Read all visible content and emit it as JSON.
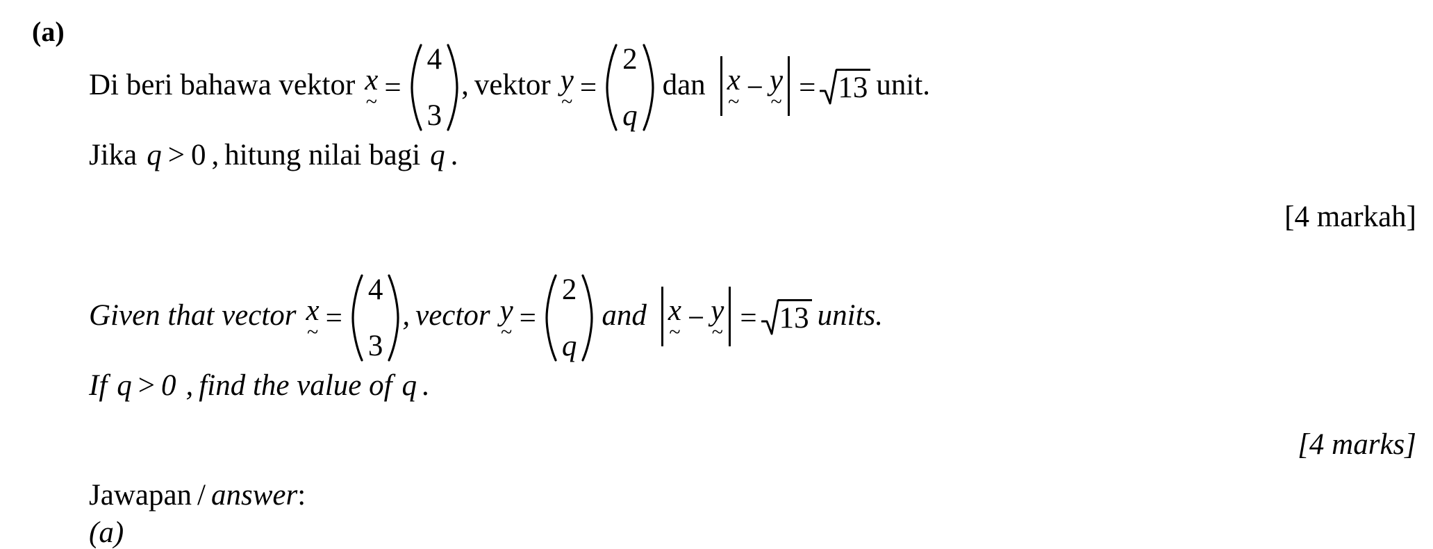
{
  "question": {
    "part_label": "(a)",
    "malay": {
      "line1": {
        "prefix": "Di beri bahawa vektor",
        "var1": "x",
        "equals": "=",
        "vector1": {
          "top": "4",
          "bottom": "3"
        },
        "comma": ",",
        "mid": "vektor",
        "var2": "y",
        "vector2": {
          "top": "2",
          "bottom": "q"
        },
        "conj": "dan",
        "abs_left_var": "x",
        "minus": "−",
        "abs_right_var": "y",
        "equals2": "=",
        "radicand": "13",
        "unit": "unit."
      },
      "line2": {
        "prefix": "Jika",
        "cond_var": "q",
        "cond_op": ">",
        "cond_val": "0",
        "comma": ",",
        "instruction": "hitung nilai bagi",
        "target_var": "q",
        "period": "."
      },
      "marks": "[4 markah]"
    },
    "english": {
      "line1": {
        "prefix": "Given that vector",
        "var1": "x",
        "equals": "=",
        "vector1": {
          "top": "4",
          "bottom": "3"
        },
        "comma": ",",
        "mid": "vector",
        "var2": "y",
        "vector2": {
          "top": "2",
          "bottom": "q"
        },
        "conj": "and",
        "abs_left_var": "x",
        "minus": "−",
        "abs_right_var": "y",
        "equals2": "=",
        "radicand": "13",
        "unit": "units."
      },
      "line2": {
        "prefix": "If",
        "cond_var": "q",
        "cond_op": ">",
        "cond_val": "0",
        "comma": ",",
        "instruction": "find the value of",
        "target_var": "q",
        "period": "."
      },
      "marks": "[4 marks]"
    },
    "answer_section": {
      "label_malay": "Jawapan",
      "separator": "/",
      "label_english": "answer",
      "colon": ":",
      "answer_part_label": "(a)"
    },
    "tilde": "~"
  },
  "colors": {
    "background": "#ffffff",
    "text": "#000000"
  }
}
